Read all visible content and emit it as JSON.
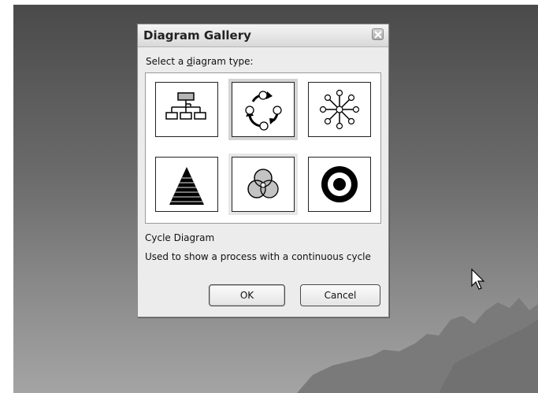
{
  "dialog": {
    "title": "Diagram Gallery",
    "prompt_prefix": "Select a ",
    "prompt_mnemonic": "d",
    "prompt_suffix": "iagram type:",
    "diagram_types": [
      {
        "icon": "organization-chart-icon"
      },
      {
        "icon": "cycle-diagram-icon",
        "selected": true
      },
      {
        "icon": "radial-diagram-icon"
      },
      {
        "icon": "pyramid-diagram-icon"
      },
      {
        "icon": "venn-diagram-icon"
      },
      {
        "icon": "target-diagram-icon"
      }
    ],
    "selected_name": "Cycle Diagram",
    "selected_description": "Used to show a process with a continuous cycle",
    "ok_label": "OK",
    "cancel_label": "Cancel"
  },
  "colors": {
    "desktop_top": "#4a4a4a",
    "dialog_bg": "#ececec",
    "selection_frame": "#d4d4d4"
  }
}
